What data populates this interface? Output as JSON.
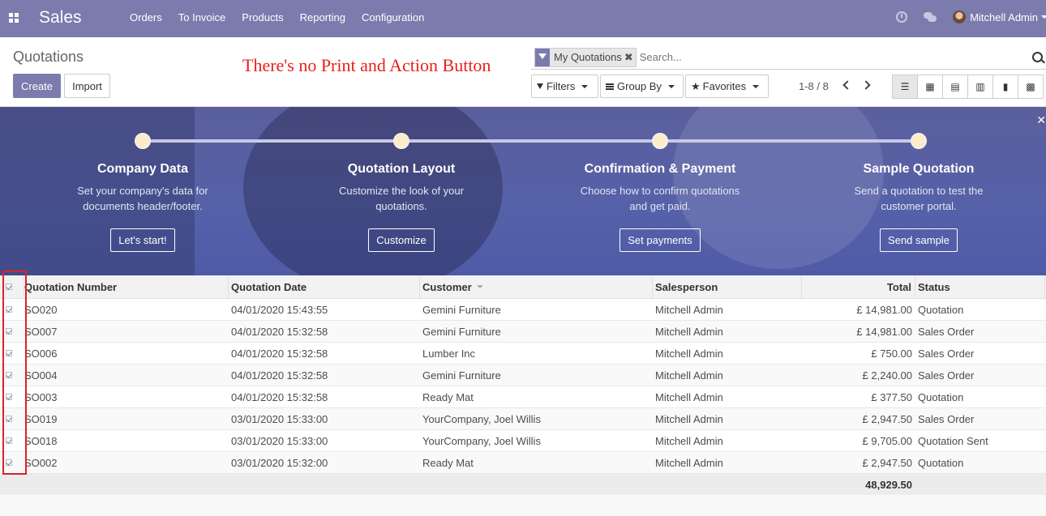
{
  "navbar": {
    "brand": "Sales",
    "menu": [
      "Orders",
      "To Invoice",
      "Products",
      "Reporting",
      "Configuration"
    ],
    "user": "Mitchell Admin",
    "bg_color": "#7c7bad"
  },
  "control_panel": {
    "breadcrumb": "Quotations",
    "create_label": "Create",
    "import_label": "Import",
    "annotation": "There's no Print and Action Button",
    "search": {
      "facet": "My Quotations",
      "placeholder": "Search..."
    },
    "filters_label": "Filters",
    "groupby_label": "Group By",
    "favorites_label": "Favorites",
    "pager": "1-8 / 8",
    "views": [
      "list-view-icon",
      "kanban-view-icon",
      "calendar-view-icon",
      "pivot-view-icon",
      "graph-view-icon",
      "activity-view-icon"
    ]
  },
  "banner": {
    "steps": [
      {
        "title": "Company Data",
        "desc1": "Set your company's data for",
        "desc2": "documents header/footer.",
        "button": "Let's start!"
      },
      {
        "title": "Quotation Layout",
        "desc1": "Customize the look of your",
        "desc2": "quotations.",
        "button": "Customize"
      },
      {
        "title": "Confirmation & Payment",
        "desc1": "Choose how to confirm quotations",
        "desc2": "and get paid.",
        "button": "Set payments"
      },
      {
        "title": "Sample Quotation",
        "desc1": "Send a quotation to test the",
        "desc2": "customer portal.",
        "button": "Send sample"
      }
    ]
  },
  "table": {
    "headers": [
      "Quotation Number",
      "Quotation Date",
      "Customer",
      "Salesperson",
      "Total",
      "Status"
    ],
    "rows": [
      {
        "number": "SO020",
        "date": "04/01/2020 15:43:55",
        "customer": "Gemini Furniture",
        "salesperson": "Mitchell Admin",
        "total": "£ 14,981.00",
        "status": "Quotation"
      },
      {
        "number": "SO007",
        "date": "04/01/2020 15:32:58",
        "customer": "Gemini Furniture",
        "salesperson": "Mitchell Admin",
        "total": "£ 14,981.00",
        "status": "Sales Order"
      },
      {
        "number": "SO006",
        "date": "04/01/2020 15:32:58",
        "customer": "Lumber Inc",
        "salesperson": "Mitchell Admin",
        "total": "£ 750.00",
        "status": "Sales Order"
      },
      {
        "number": "SO004",
        "date": "04/01/2020 15:32:58",
        "customer": "Gemini Furniture",
        "salesperson": "Mitchell Admin",
        "total": "£ 2,240.00",
        "status": "Sales Order"
      },
      {
        "number": "SO003",
        "date": "04/01/2020 15:32:58",
        "customer": "Ready Mat",
        "salesperson": "Mitchell Admin",
        "total": "£ 377.50",
        "status": "Quotation"
      },
      {
        "number": "SO019",
        "date": "03/01/2020 15:33:00",
        "customer": "YourCompany, Joel Willis",
        "salesperson": "Mitchell Admin",
        "total": "£ 2,947.50",
        "status": "Sales Order"
      },
      {
        "number": "SO018",
        "date": "03/01/2020 15:33:00",
        "customer": "YourCompany, Joel Willis",
        "salesperson": "Mitchell Admin",
        "total": "£ 9,705.00",
        "status": "Quotation Sent"
      },
      {
        "number": "SO002",
        "date": "03/01/2020 15:32:00",
        "customer": "Ready Mat",
        "salesperson": "Mitchell Admin",
        "total": "£ 2,947.50",
        "status": "Quotation"
      }
    ],
    "footer_total": "48,929.50"
  }
}
